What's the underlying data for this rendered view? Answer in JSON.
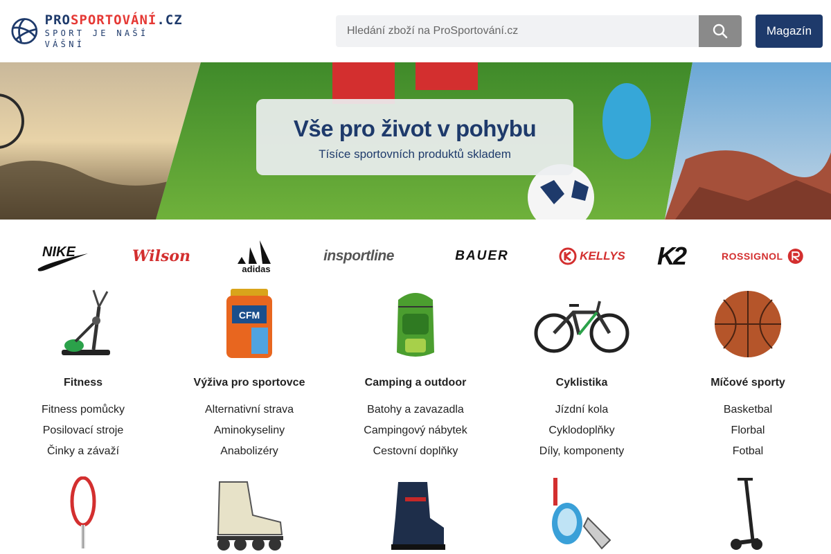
{
  "header": {
    "logo_top_pro": "PRO",
    "logo_top_sport": "SPORTOVÁNÍ",
    "logo_top_cz": ".CZ",
    "logo_bottom": "SPORT JE NAŠÍ VÁŠNÍ",
    "search_placeholder": "Hledání zboží na ProSportování.cz",
    "magazin_label": "Magazín"
  },
  "banner": {
    "title": "Vše pro život v pohybu",
    "subtitle": "Tísíce sportovních produktů skladem"
  },
  "brands": [
    "NIKE",
    "Wilson",
    "adidas",
    "insportline",
    "BAUER",
    "KELLYS",
    "K2",
    "ROSSIGNOL"
  ],
  "categories": [
    {
      "title": "Fitness",
      "links": [
        "Fitness pomůcky",
        "Posilovací stroje",
        "Činky a závaží"
      ]
    },
    {
      "title": "Výživa pro sportovce",
      "links": [
        "Alternativní strava",
        "Aminokyseliny",
        "Anabolizéry"
      ]
    },
    {
      "title": "Camping a outdoor",
      "links": [
        "Batohy a zavazadla",
        "Campingový nábytek",
        "Cestovní doplňky"
      ]
    },
    {
      "title": "Cyklistika",
      "links": [
        "Jízdní kola",
        "Cyklodoplňky",
        "Díly, komponenty"
      ]
    },
    {
      "title": "Míčové sporty",
      "links": [
        "Basketbal",
        "Florbal",
        "Fotbal"
      ]
    }
  ],
  "colors": {
    "brand_navy": "#1e3a6b",
    "brand_red": "#e53935",
    "search_button": "#8a8a8a"
  }
}
